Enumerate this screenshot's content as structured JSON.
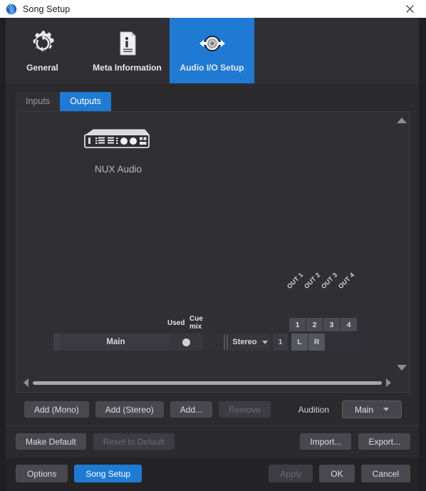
{
  "titlebar": {
    "title": "Song Setup",
    "app_icon": "app-sphere-icon",
    "close_icon": "close-icon"
  },
  "tabs": [
    {
      "label": "General",
      "icon": "gear-refresh-icon",
      "active": false
    },
    {
      "label": "Meta Information",
      "icon": "document-info-icon",
      "active": false
    },
    {
      "label": "Audio I/O Setup",
      "icon": "audio-io-jack-icon",
      "active": true
    }
  ],
  "subtabs": [
    {
      "label": "Inputs",
      "active": false
    },
    {
      "label": "Outputs",
      "active": true
    }
  ],
  "device": {
    "name": "NUX Audio",
    "icon": "audio-interface-icon"
  },
  "matrix": {
    "out_headers": [
      "OUT 1",
      "OUT 2",
      "OUT 3",
      "OUT 4"
    ],
    "channel_numbers": [
      "1",
      "2",
      "3",
      "4"
    ],
    "column_used": "Used",
    "column_cue_line1": "Cue",
    "column_cue_line2": "mix"
  },
  "bus_row": {
    "name": "Main",
    "used": true,
    "mode": "Stereo",
    "count": "1",
    "assignments": [
      "L",
      "R",
      "",
      ""
    ]
  },
  "add_row": {
    "add_mono": "Add (Mono)",
    "add_stereo": "Add (Stereo)",
    "add_more": "Add...",
    "remove": "Remove",
    "remove_disabled": true,
    "audition_label": "Audition",
    "audition_value": "Main"
  },
  "default_row": {
    "make_default": "Make Default",
    "reset_to_default": "Reset to Default",
    "reset_disabled": true,
    "import": "Import...",
    "export": "Export..."
  },
  "bottom_row": {
    "options": "Options",
    "song_setup": "Song Setup",
    "apply": "Apply",
    "apply_disabled": true,
    "ok": "OK",
    "cancel": "Cancel"
  },
  "colors": {
    "accent": "#1f7ad4",
    "window_bg": "#2b2b2e",
    "panel_bg": "#303034",
    "titlebar_bg": "#ffffff",
    "button_bg": "#48484e",
    "disabled_text": "#6a6a70"
  }
}
